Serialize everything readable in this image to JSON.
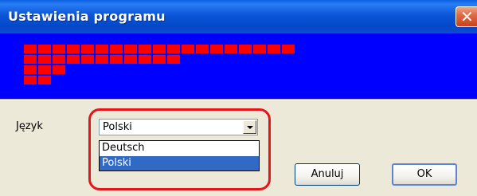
{
  "window": {
    "title": "Ustawienia programu",
    "close_symbol": "✕"
  },
  "banner": {
    "colors": {
      "background": "#0000ff",
      "squares": "#ff0000"
    },
    "square_rows": [
      19,
      11,
      3,
      2
    ]
  },
  "language": {
    "label": "Język",
    "selected": "Polski",
    "options": [
      "Deutsch",
      "Polski"
    ],
    "highlighted_option": "Polski"
  },
  "annotation": {
    "color": "#e8141a"
  },
  "buttons": {
    "cancel": "Anuluj",
    "ok": "OK"
  }
}
